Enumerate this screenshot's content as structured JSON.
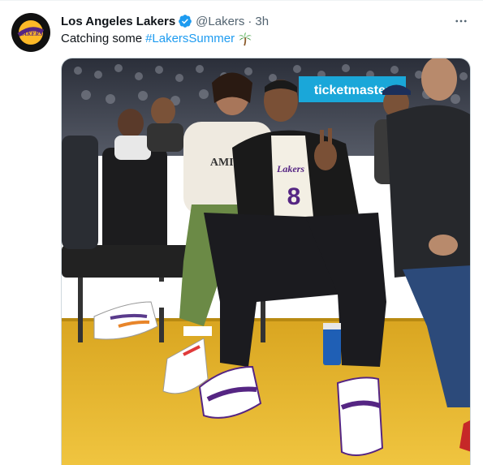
{
  "tweet": {
    "author_name": "Los Angeles Lakers",
    "handle": "@Lakers",
    "separator": "·",
    "time": "3h",
    "text_prefix": "Catching some",
    "hashtag": "#LakersSummer",
    "emoji": "palm-tree",
    "avatar_logo_text": "LAKERS",
    "verified": true
  },
  "media": {
    "banner_text": "ticketmaster",
    "hoodie_text": "AMIRI",
    "jersey_number": "8",
    "jersey_text": "Lakers"
  },
  "colors": {
    "link": "#1d9bf0",
    "secondary_text": "#536471",
    "lakers_purple": "#552583",
    "lakers_gold": "#FDB927",
    "court": "#e8b42a"
  }
}
